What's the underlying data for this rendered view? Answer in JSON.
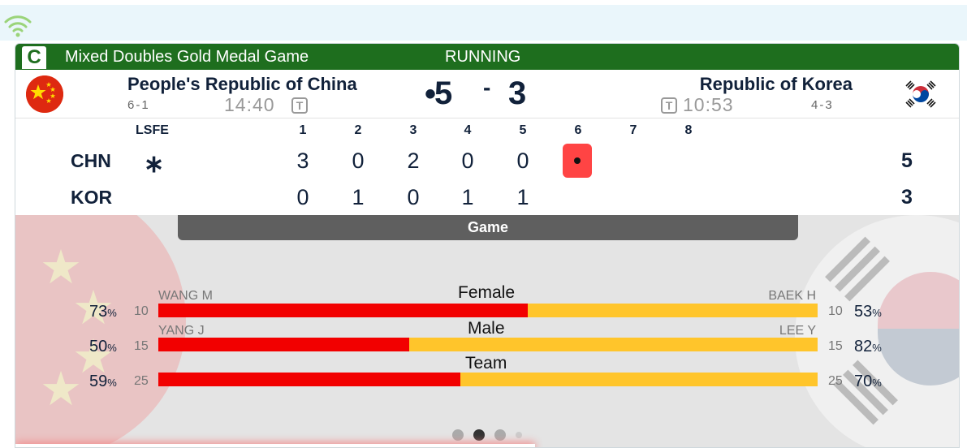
{
  "header": {
    "sheet_badge": "C",
    "game_title": "Mixed Doubles Gold Medal Game",
    "status": "RUNNING"
  },
  "teams": {
    "home": {
      "name": "People's Republic of China",
      "record": "6-1",
      "clock": "14:40",
      "timeout_label": "T",
      "score": "5",
      "hammer_indicator": "•",
      "flag": "china-flag-icon"
    },
    "away": {
      "name": "Republic of Korea",
      "record": "4-3",
      "clock": "10:53",
      "timeout_label": "T",
      "score": "3",
      "flag": "korea-flag-icon"
    }
  },
  "score_separator": "-",
  "linescore": {
    "lsfe_label": "LSFE",
    "ends": [
      "1",
      "2",
      "3",
      "4",
      "5",
      "6",
      "7",
      "8"
    ],
    "rows": [
      {
        "abbr": "CHN",
        "lsfe_mark": "∗",
        "scores": [
          "3",
          "0",
          "2",
          "0",
          "0"
        ],
        "current_end": "6",
        "total": "5"
      },
      {
        "abbr": "KOR",
        "scores": [
          "0",
          "1",
          "0",
          "1",
          "1"
        ],
        "total": "3"
      }
    ]
  },
  "stats": {
    "tab_label": "Game",
    "categories": [
      {
        "label": "Female",
        "left_player": "WANG M",
        "right_player": "BAEK H",
        "left_pct": "73",
        "left_count": "10",
        "right_pct": "53",
        "right_count": "10",
        "left_share": 0.56
      },
      {
        "label": "Male",
        "left_player": "YANG J",
        "right_player": "LEE Y",
        "left_pct": "50",
        "left_count": "15",
        "right_pct": "82",
        "right_count": "15",
        "left_share": 0.38
      },
      {
        "label": "Team",
        "left_pct": "59",
        "left_count": "25",
        "right_pct": "70",
        "right_count": "25",
        "left_share": 0.458
      }
    ],
    "pct_unit": "%"
  },
  "carousel": {
    "pages": 4,
    "active": 1
  },
  "colors": {
    "header_green": "#1e6e1e",
    "home_bar": "#f20000",
    "away_bar": "#ffc52b",
    "live_end": "#ff4444"
  }
}
